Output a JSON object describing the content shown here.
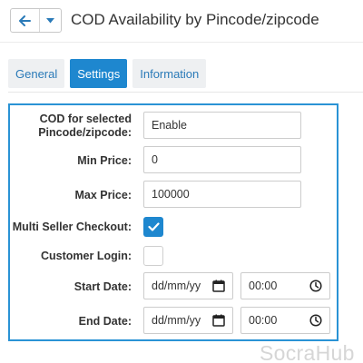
{
  "header": {
    "title": "COD Availability by Pincode/zipcode",
    "back_icon": "arrow-left-icon",
    "dropdown_icon": "caret-down-icon"
  },
  "tabs": [
    {
      "label": "General",
      "active": false
    },
    {
      "label": "Settings",
      "active": true
    },
    {
      "label": "Information",
      "active": false
    }
  ],
  "form": {
    "cod_label_line1": "COD for selected",
    "cod_label_line2": "Pincode/zipcode:",
    "cod_value": "Enable",
    "min_price_label": "Min Price:",
    "min_price_value": "0",
    "max_price_label": "Max Price:",
    "max_price_value": "100000",
    "multi_seller_label": "Multi Seller Checkout:",
    "multi_seller_checked": true,
    "customer_login_label": "Customer Login:",
    "customer_login_checked": false,
    "start_date_label": "Start Date:",
    "start_date_placeholder": "dd/mm/yy",
    "start_time_value": "00:00",
    "end_date_label": "End Date:",
    "end_date_placeholder": "dd/mm/yy",
    "end_time_value": "00:00"
  },
  "watermark": "SocraHub",
  "colors": {
    "accent": "#1e87cf",
    "panel_border": "#2a93d5",
    "tab_text": "#2a7ab8"
  }
}
